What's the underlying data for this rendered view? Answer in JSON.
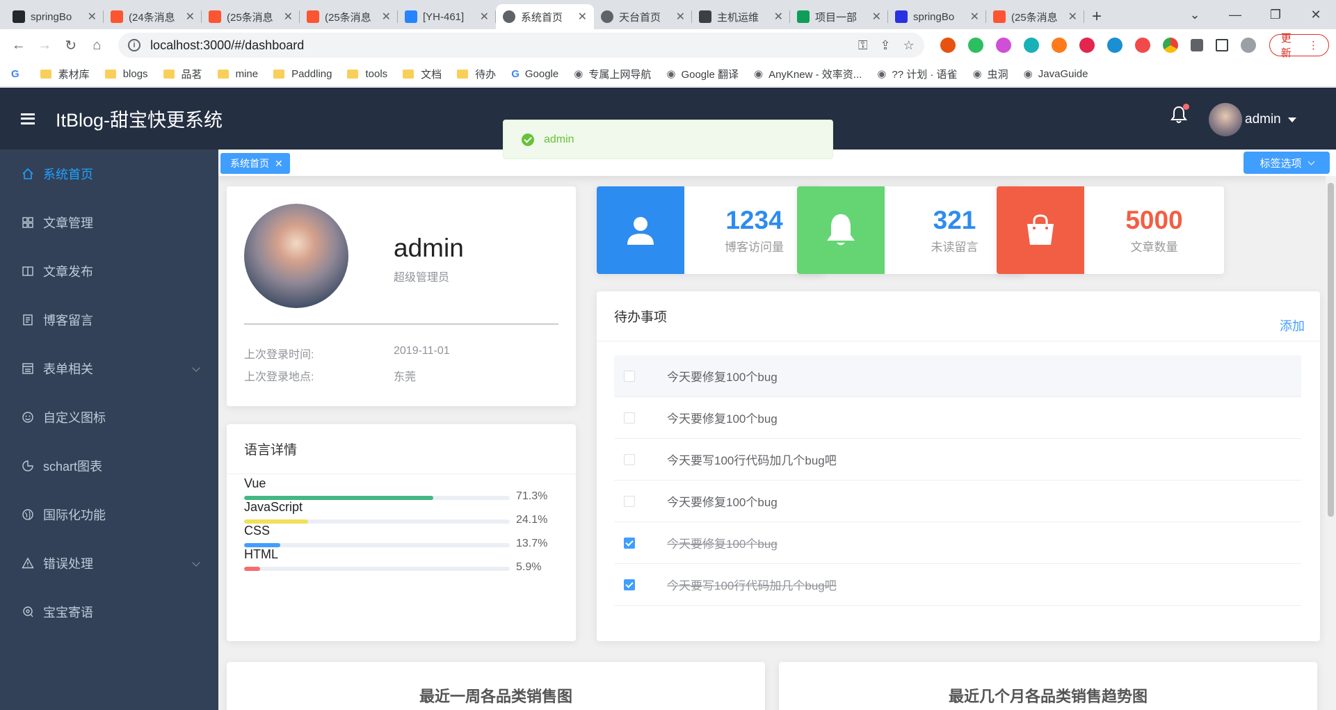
{
  "browser": {
    "tabs": [
      {
        "title": "springBo",
        "favicon_color": "#24292e",
        "favicon": "github-icon"
      },
      {
        "title": "(24条消息",
        "favicon_color": "#fc5531",
        "favicon": "csdn-icon"
      },
      {
        "title": "(25条消息",
        "favicon_color": "#fc5531",
        "favicon": "csdn-icon"
      },
      {
        "title": "(25条消息",
        "favicon_color": "#fc5531",
        "favicon": "csdn-icon"
      },
      {
        "title": "[YH-461]",
        "favicon_color": "#2684ff",
        "favicon": "jira-icon"
      },
      {
        "title": "系统首页",
        "favicon_color": "#5f6368",
        "favicon": "globe-icon",
        "active": true
      },
      {
        "title": "天台首页",
        "favicon_color": "#5f6368",
        "favicon": "globe-icon"
      },
      {
        "title": "主机运维",
        "favicon_color": "#3c4043",
        "favicon": "shield-icon"
      },
      {
        "title": "项目一部",
        "favicon_color": "#0f9d58",
        "favicon": "sheets-icon"
      },
      {
        "title": "springBo",
        "favicon_color": "#2932e1",
        "favicon": "baidu-icon"
      },
      {
        "title": "(25条消息",
        "favicon_color": "#fc5531",
        "favicon": "csdn-icon"
      }
    ],
    "url": "localhost:3000/#/dashboard",
    "update_label": "更新",
    "bookmarks": [
      {
        "label": "",
        "type": "google"
      },
      {
        "label": "素材库",
        "type": "folder"
      },
      {
        "label": "blogs",
        "type": "folder"
      },
      {
        "label": "品茗",
        "type": "folder"
      },
      {
        "label": "mine",
        "type": "folder"
      },
      {
        "label": "Paddling",
        "type": "folder"
      },
      {
        "label": "tools",
        "type": "folder"
      },
      {
        "label": "文档",
        "type": "folder"
      },
      {
        "label": "待办",
        "type": "folder"
      },
      {
        "label": "Google",
        "type": "google"
      },
      {
        "label": "专属上网导航",
        "type": "link"
      },
      {
        "label": "Google 翻译",
        "type": "link"
      },
      {
        "label": "AnyKnew - 效率资...",
        "type": "link"
      },
      {
        "label": "?? 计划 · 语雀",
        "type": "link"
      },
      {
        "label": "虫洞",
        "type": "link"
      },
      {
        "label": "JavaGuide",
        "type": "link"
      }
    ]
  },
  "header": {
    "title": "ItBlog-甜宝快更系统",
    "username": "admin"
  },
  "toast": {
    "message": "admin",
    "color": "#67c23a"
  },
  "sidebar": {
    "items": [
      {
        "label": "系统首页",
        "icon": "home-icon",
        "active": true
      },
      {
        "label": "文章管理",
        "icon": "grid-icon"
      },
      {
        "label": "文章发布",
        "icon": "book-icon"
      },
      {
        "label": "博客留言",
        "icon": "document-icon"
      },
      {
        "label": "表单相关",
        "icon": "form-icon",
        "expandable": true
      },
      {
        "label": "自定义图标",
        "icon": "smile-icon"
      },
      {
        "label": "schart图表",
        "icon": "pie-chart-icon"
      },
      {
        "label": "国际化功能",
        "icon": "globe-icon"
      },
      {
        "label": "错误处理",
        "icon": "warning-icon",
        "expandable": true
      },
      {
        "label": "宝宝寄语",
        "icon": "location-icon"
      }
    ]
  },
  "tags": {
    "active_tag": "系统首页",
    "options_label": "标签选项"
  },
  "user_card": {
    "name": "admin",
    "role": "超级管理员",
    "last_login_time_label": "上次登录时间:",
    "last_login_time": "2019-11-01",
    "last_login_place_label": "上次登录地点:",
    "last_login_place": "东莞"
  },
  "lang_card": {
    "title": "语言详情",
    "items": [
      {
        "name": "Vue",
        "percent": 71.3,
        "label": "71.3%",
        "color": "#42b983"
      },
      {
        "name": "JavaScript",
        "percent": 24.1,
        "label": "24.1%",
        "color": "#f1e05a"
      },
      {
        "name": "CSS",
        "percent": 13.7,
        "label": "13.7%",
        "color": "#409eff"
      },
      {
        "name": "HTML",
        "percent": 5.9,
        "label": "5.9%",
        "color": "#f56c6c"
      }
    ]
  },
  "stats": [
    {
      "value": "1234",
      "label": "博客访问量",
      "color": "#2d8cf0",
      "icon": "user-icon"
    },
    {
      "value": "321",
      "label": "未读留言",
      "color": "#64d572",
      "icon": "bell-icon"
    },
    {
      "value": "5000",
      "label": "文章数量",
      "color": "#f25e43",
      "icon": "bag-icon"
    }
  ],
  "todo": {
    "title": "待办事项",
    "add_label": "添加",
    "items": [
      {
        "text": "今天要修复100个bug",
        "done": false
      },
      {
        "text": "今天要修复100个bug",
        "done": false
      },
      {
        "text": "今天要写100行代码加几个bug吧",
        "done": false
      },
      {
        "text": "今天要修复100个bug",
        "done": false
      },
      {
        "text": "今天要修复100个bug",
        "done": true
      },
      {
        "text": "今天要写100行代码加几个bug吧",
        "done": true
      }
    ]
  },
  "charts": {
    "left_title": "最近一周各品类销售图",
    "right_title": "最近几个月各品类销售趋势图"
  }
}
